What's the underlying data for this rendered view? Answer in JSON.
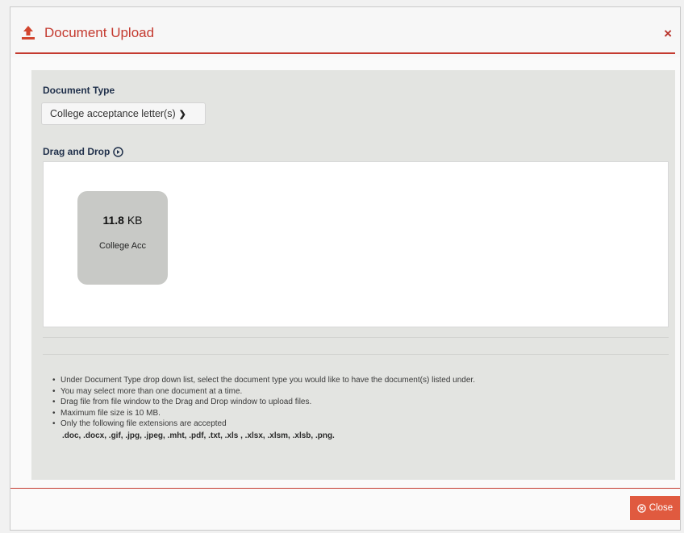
{
  "modal": {
    "title": "Document Upload",
    "close_x": "×",
    "icon": "upload-icon"
  },
  "document_type": {
    "label": "Document Type",
    "selected": "College acceptance letter(s)"
  },
  "drag_drop": {
    "label": "Drag and Drop",
    "info_icon": "info-circle-icon",
    "files": [
      {
        "size_value": "11.8",
        "size_unit": "KB",
        "name": "College Acc"
      }
    ]
  },
  "instructions": [
    "Under Document Type drop down list, select the document type you would like to have the document(s) listed under.",
    "You may select more than one document at a time.",
    "Drag file from file window to the Drag and Drop window to upload files.",
    "Maximum file size is 10 MB.",
    "Only the following file extensions are accepted"
  ],
  "extensions_text": ".doc, .docx, .gif, .jpg, .jpeg, .mht, .pdf, .txt, .xls , .xlsx, .xlsm, .xlsb, .png.",
  "footer": {
    "close_label": "Close",
    "close_icon": "circle-x-icon"
  },
  "colors": {
    "accent": "#c43a2f",
    "close_button": "#e05a3f",
    "heading": "#1f2f4a"
  }
}
